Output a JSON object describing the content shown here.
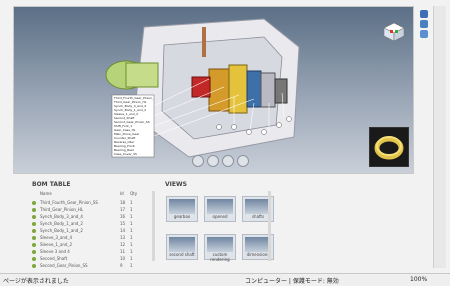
{
  "viewport": {
    "annotation_rows": [
      "Third_Fourth_Gear_Pinion_SS",
      "Third_Gear_Pinion_HL",
      "Synch_Body_3_and_4",
      "Synch_Body_1_and_2",
      "Sleeve_1_and_2",
      "Second_Shaft",
      "Second_Gear_Pinion_SS",
      "Shift_Fork_1",
      "Gear_Case_HL",
      "Main_Drive_Gear",
      "Counter_Shaft",
      "Reverse_Idler",
      "Bearing_Front",
      "Bearing_Rear",
      "Case_Cover_SS"
    ]
  },
  "bom": {
    "title": "BOM TABLE",
    "headers": {
      "name": "Name",
      "id": "Id",
      "qty": "Qty"
    },
    "rows": [
      {
        "name": "Third_Fourth_Gear_Pinion_SS",
        "id": "18",
        "qty": "1"
      },
      {
        "name": "Third_Gear_Pinion_HL",
        "id": "17",
        "qty": "1"
      },
      {
        "name": "Synch_Body_3_and_4",
        "id": "16",
        "qty": "1"
      },
      {
        "name": "Synch_Body_1_and_2",
        "id": "15",
        "qty": "1"
      },
      {
        "name": "Synch_Body_1_and_2",
        "id": "14",
        "qty": "1"
      },
      {
        "name": "Sleeve_3_and_4",
        "id": "13",
        "qty": "1"
      },
      {
        "name": "Sleeve_1_and_2",
        "id": "12",
        "qty": "1"
      },
      {
        "name": "Sleeve 3 and 4",
        "id": "11",
        "qty": "1"
      },
      {
        "name": "Second_Shaft",
        "id": "10",
        "qty": "1"
      },
      {
        "name": "Second_Gear_Pinion_SS",
        "id": "9",
        "qty": "1"
      }
    ]
  },
  "views": {
    "title": "VIEWS",
    "items": [
      {
        "label": "gearbox"
      },
      {
        "label": "opened"
      },
      {
        "label": "shafts"
      },
      {
        "label": "second shaft"
      },
      {
        "label": "custom rendering"
      },
      {
        "label": "dimensions"
      }
    ]
  },
  "status": {
    "left": "ページが表示されました",
    "zone": "コンピューター | 保護モード: 無効",
    "zoom": "100%"
  },
  "colors": {
    "accent": "#7aa83a"
  }
}
